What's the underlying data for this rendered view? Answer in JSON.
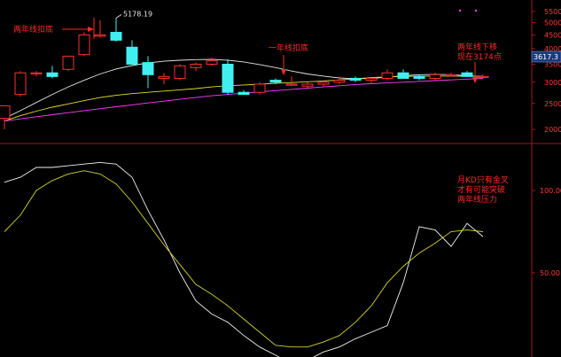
{
  "chart_data": [
    {
      "type": "candlestick",
      "panel": "price",
      "ylim": [
        1800,
        5800
      ],
      "y_ticks": [
        2000,
        2500,
        3000,
        3500,
        4000,
        4500,
        5000,
        5500
      ],
      "y_tick_labels": [
        "2000",
        "2500",
        "3000",
        "3500",
        "4000",
        "4500",
        "5000",
        "5500"
      ],
      "current_price_label": "3617.3",
      "peak_label": "5178.19",
      "candles": [
        {
          "o": 2200,
          "h": 2450,
          "l": 2000,
          "c": 2450
        },
        {
          "o": 2700,
          "h": 3300,
          "l": 2650,
          "c": 3250
        },
        {
          "o": 3250,
          "h": 3300,
          "l": 3150,
          "c": 3250
        },
        {
          "o": 3250,
          "h": 3450,
          "l": 3100,
          "c": 3150
        },
        {
          "o": 3350,
          "h": 3750,
          "l": 3300,
          "c": 3750
        },
        {
          "o": 3800,
          "h": 4600,
          "l": 3750,
          "c": 4500
        },
        {
          "o": 4450,
          "h": 5100,
          "l": 4400,
          "c": 4500
        },
        {
          "o": 4600,
          "h": 5200,
          "l": 4250,
          "c": 4300
        },
        {
          "o": 4050,
          "h": 4300,
          "l": 3550,
          "c": 3500
        },
        {
          "o": 3550,
          "h": 3750,
          "l": 2850,
          "c": 3200
        },
        {
          "o": 3100,
          "h": 3250,
          "l": 2950,
          "c": 3150
        },
        {
          "o": 3100,
          "h": 3500,
          "l": 3050,
          "c": 3450
        },
        {
          "o": 3400,
          "h": 3550,
          "l": 3300,
          "c": 3500
        },
        {
          "o": 3500,
          "h": 3700,
          "l": 3450,
          "c": 3600
        },
        {
          "o": 3500,
          "h": 3650,
          "l": 2700,
          "c": 2750
        },
        {
          "o": 2750,
          "h": 2800,
          "l": 2700,
          "c": 2700
        },
        {
          "o": 2750,
          "h": 3000,
          "l": 2700,
          "c": 2950
        },
        {
          "o": 3050,
          "h": 3100,
          "l": 2950,
          "c": 3000
        },
        {
          "o": 2950,
          "h": 3150,
          "l": 2900,
          "c": 2950
        },
        {
          "o": 2900,
          "h": 3000,
          "l": 2850,
          "c": 2950
        },
        {
          "o": 2950,
          "h": 3050,
          "l": 2900,
          "c": 3000
        },
        {
          "o": 3000,
          "h": 3150,
          "l": 2950,
          "c": 3050
        },
        {
          "o": 3100,
          "h": 3150,
          "l": 3000,
          "c": 3050
        },
        {
          "o": 3050,
          "h": 3100,
          "l": 2950,
          "c": 3100
        },
        {
          "o": 3100,
          "h": 3350,
          "l": 3050,
          "c": 3250
        },
        {
          "o": 3250,
          "h": 3350,
          "l": 3100,
          "c": 3100
        },
        {
          "o": 3150,
          "h": 3200,
          "l": 3050,
          "c": 3100
        },
        {
          "o": 3100,
          "h": 3250,
          "l": 3050,
          "c": 3200
        },
        {
          "o": 3200,
          "h": 3250,
          "l": 3150,
          "c": 3200
        },
        {
          "o": 3250,
          "h": 3300,
          "l": 3150,
          "c": 3150
        },
        {
          "o": 3150,
          "h": 3200,
          "l": 3100,
          "c": 3150
        }
      ],
      "ma_lines": [
        {
          "name": "MA-white",
          "color": "#e6e6e6",
          "values": [
            2200,
            2350,
            2520,
            2700,
            2880,
            3050,
            3220,
            3360,
            3460,
            3540,
            3590,
            3620,
            3640,
            3650,
            3620,
            3570,
            3490,
            3400,
            3300,
            3220,
            3160,
            3110,
            3090,
            3100,
            3130,
            3170,
            3200,
            3210,
            3200,
            3170,
            3150
          ]
        },
        {
          "name": "MA-yellow",
          "color": "#e0e030",
          "values": [
            2150,
            2250,
            2340,
            2420,
            2490,
            2560,
            2630,
            2680,
            2720,
            2750,
            2780,
            2810,
            2840,
            2880,
            2910,
            2930,
            2950,
            2970,
            2990,
            3010,
            3030,
            3060,
            3090,
            3120,
            3140,
            3150,
            3160,
            3160,
            3160,
            3160,
            3160
          ]
        },
        {
          "name": "MA-magenta",
          "color": "#ff40ff",
          "values": [
            2150,
            2190,
            2230,
            2270,
            2310,
            2350,
            2390,
            2430,
            2470,
            2510,
            2550,
            2590,
            2630,
            2670,
            2700,
            2730,
            2760,
            2790,
            2820,
            2850,
            2880,
            2910,
            2940,
            2960,
            2980,
            3000,
            3020,
            3040,
            3060,
            3080,
            3100
          ]
        }
      ],
      "annotations": [
        {
          "text": "两年线扣底",
          "style": "ann"
        },
        {
          "text": "一年线扣底",
          "style": "ann"
        },
        {
          "text": "两年线下移",
          "style": "ann"
        },
        {
          "text": "现在3174点",
          "style": "ann"
        }
      ]
    },
    {
      "type": "line",
      "panel": "kd",
      "ylim": [
        0,
        120
      ],
      "y_ticks": [
        100,
        50
      ],
      "y_tick_labels": [
        "100.00",
        "50.00"
      ],
      "x": [
        0,
        1,
        2,
        3,
        4,
        5,
        6,
        7,
        8,
        9,
        10,
        11,
        12,
        13,
        14,
        15,
        16,
        17,
        18,
        19,
        20,
        21,
        22,
        23,
        24,
        25,
        26,
        27,
        28,
        29,
        30
      ],
      "series": [
        {
          "name": "K",
          "color": "#f2f2f2",
          "values": [
            105,
            108,
            114,
            114,
            115,
            116,
            117,
            116,
            108,
            88,
            70,
            50,
            33,
            25,
            20,
            12,
            5,
            0,
            -5,
            -3,
            2,
            5,
            10,
            14,
            18,
            44,
            78,
            76,
            66,
            80,
            72
          ]
        },
        {
          "name": "D",
          "color": "#d4d430",
          "values": [
            75,
            85,
            100,
            106,
            110,
            112,
            110,
            104,
            93,
            80,
            67,
            55,
            43,
            37,
            30,
            22,
            14,
            6,
            5,
            5,
            8,
            12,
            20,
            30,
            44,
            54,
            62,
            68,
            75,
            76,
            75
          ]
        }
      ],
      "annotations": [
        {
          "text": "月KD只有金叉",
          "style": "ann"
        },
        {
          "text": "才有可能突破",
          "style": "ann"
        },
        {
          "text": "两年线压力",
          "style": "ann"
        }
      ]
    }
  ]
}
